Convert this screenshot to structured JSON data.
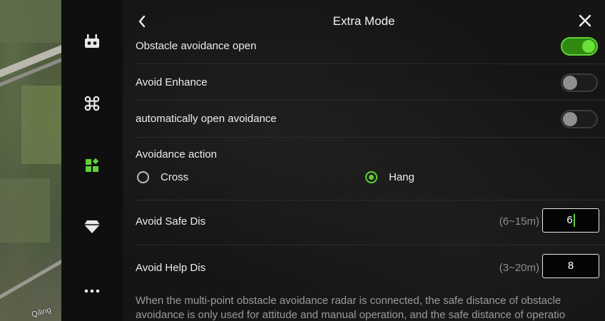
{
  "map": {
    "label": "Qiling"
  },
  "rail": {
    "items": [
      {
        "name": "remote-controller-icon",
        "glyph": "rc"
      },
      {
        "name": "aircraft-icon",
        "glyph": "⌘"
      },
      {
        "name": "extra-mode-icon",
        "glyph": "grid"
      },
      {
        "name": "diamond-icon",
        "glyph": "diamond"
      },
      {
        "name": "more-icon",
        "glyph": "•••"
      }
    ],
    "more_glyph": "•••"
  },
  "header": {
    "title": "Extra Mode"
  },
  "settings": {
    "obstacle_avoidance": {
      "label": "Obstacle avoidance open",
      "on": true
    },
    "avoid_enhance": {
      "label": "Avoid Enhance",
      "on": false
    },
    "auto_open": {
      "label": "automatically open avoidance",
      "on": false
    },
    "avoidance_action": {
      "label": "Avoidance action",
      "options": [
        "Cross",
        "Hang"
      ],
      "selected": "Hang"
    },
    "safe_dis": {
      "label": "Avoid Safe Dis",
      "range": "(6~15m)",
      "value": "6"
    },
    "help_dis": {
      "label": "Avoid Help Dis",
      "range": "(3~20m)",
      "value": "8"
    }
  },
  "note": {
    "line1": "When the multi-point obstacle avoidance radar is connected, the safe distance of obstacle",
    "line2": "avoidance is only used for attitude and manual operation, and the safe distance of operatio"
  },
  "colors": {
    "accent": "#5fd13b",
    "panel_bg": "#151614",
    "rail_bg": "#0e0f0e"
  }
}
